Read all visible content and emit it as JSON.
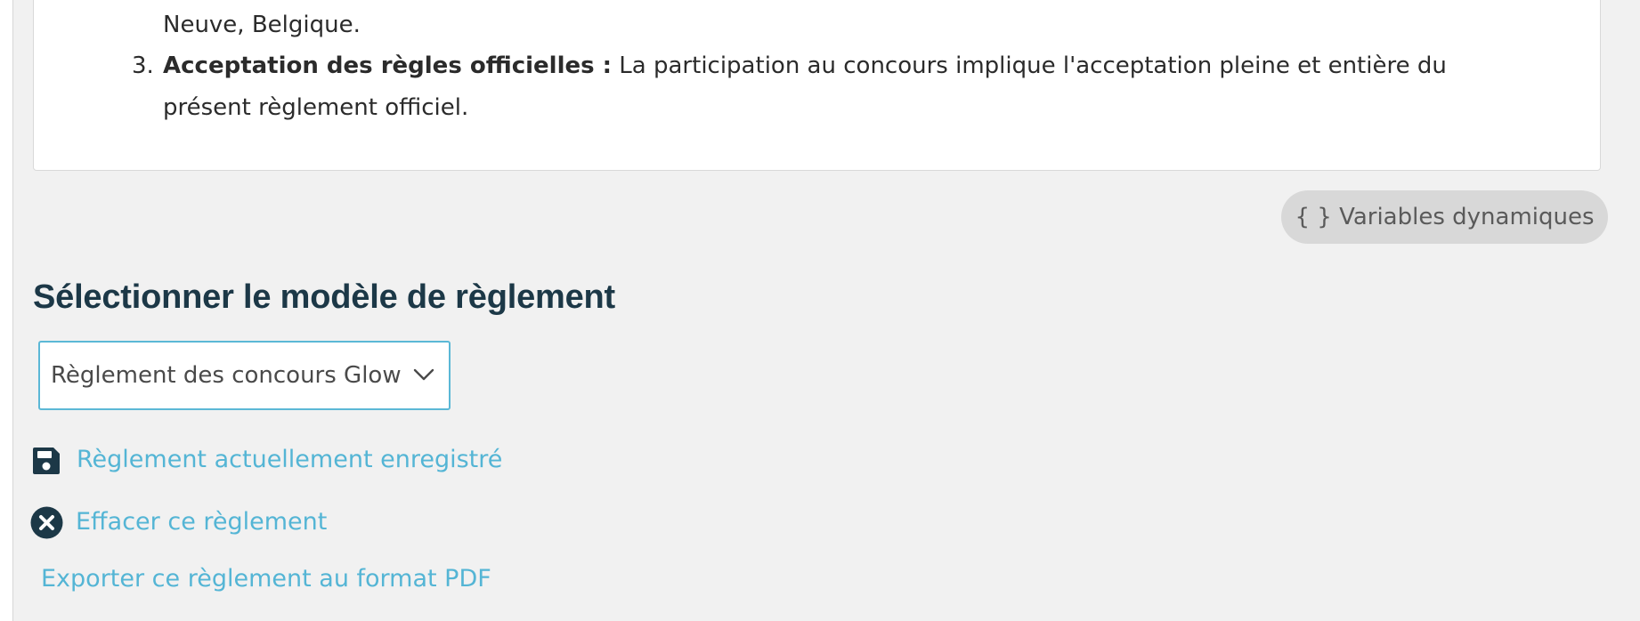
{
  "rules": {
    "partial_line_prefix": "Neuve, Belgique.",
    "item3_number": "3.",
    "item3_title": "Acceptation des règles officielles :",
    "item3_text_line1": " La participation au concours implique l'acceptation pleine et entière du",
    "item3_text_line2": "présent règlement officiel."
  },
  "variables_button": {
    "label": "{ } Variables dynamiques"
  },
  "template_section": {
    "title": "Sélectionner le modèle de règlement",
    "select_value": "Règlement des concours Glow"
  },
  "actions": {
    "saved_label": "Règlement actuellement enregistré",
    "clear_label": "Effacer ce règlement",
    "export_label": "Exporter ce règlement au format PDF"
  },
  "icons": {
    "save": "floppy-disk-icon",
    "clear": "circle-x-icon",
    "select": "chevron-down-icon"
  },
  "colors": {
    "link": "#54b5d5",
    "heading": "#1c3847",
    "icon_dark": "#1c3847",
    "select_border": "#5bb8d6",
    "panel_bg": "#f1f1f1",
    "pill_bg": "#d8d8d8"
  }
}
